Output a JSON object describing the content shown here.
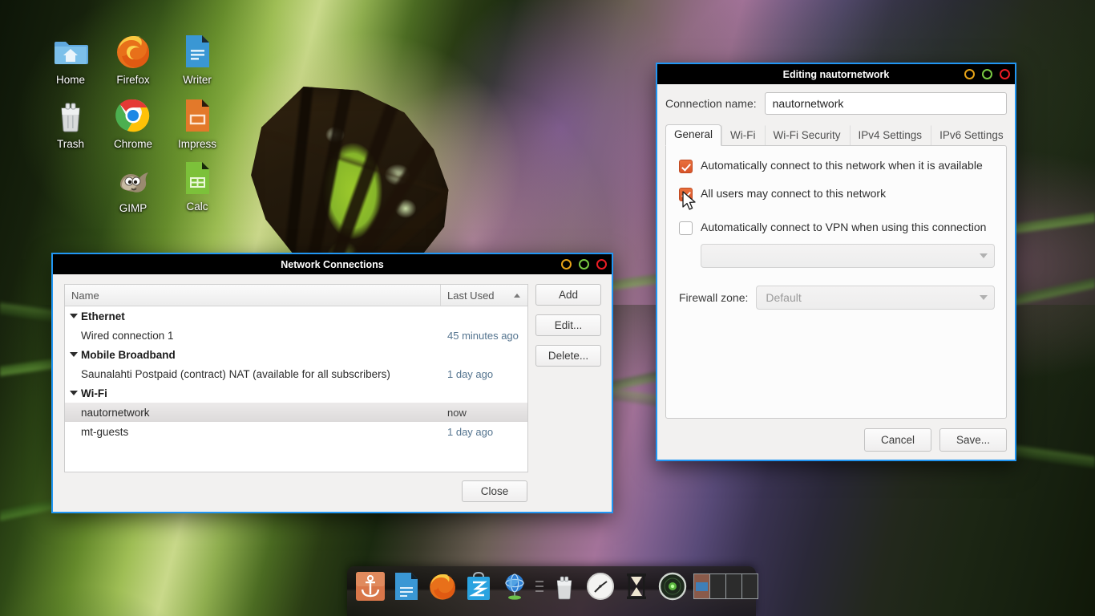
{
  "desktop": {
    "icons": [
      {
        "label": "Home",
        "icon": "home-folder-icon"
      },
      {
        "label": "Firefox",
        "icon": "firefox-icon"
      },
      {
        "label": "Writer",
        "icon": "libreoffice-writer-icon"
      },
      {
        "label": "Trash",
        "icon": "trash-icon"
      },
      {
        "label": "Chrome",
        "icon": "chrome-icon"
      },
      {
        "label": "Impress",
        "icon": "libreoffice-impress-icon"
      },
      {
        "label": "GIMP",
        "icon": "gimp-icon"
      },
      {
        "label": "Calc",
        "icon": "libreoffice-calc-icon"
      }
    ]
  },
  "dock": {
    "items": [
      {
        "name": "anchor-icon"
      },
      {
        "name": "text-editor-icon"
      },
      {
        "name": "firefox-icon"
      },
      {
        "name": "software-store-icon"
      },
      {
        "name": "network-globe-icon"
      },
      {
        "name": "separator"
      },
      {
        "name": "trash-icon"
      },
      {
        "name": "clock-icon"
      },
      {
        "name": "hourglass-icon"
      },
      {
        "name": "radar-icon"
      },
      {
        "name": "workspace-switcher-icon"
      }
    ]
  },
  "network_connections": {
    "title": "Network Connections",
    "window_buttons": {
      "minimize": "minimize-icon",
      "maximize": "maximize-icon",
      "close": "close-icon"
    },
    "columns": {
      "name": "Name",
      "last_used": "Last Used",
      "sort": "ascending"
    },
    "groups": [
      {
        "label": "Ethernet",
        "expanded": true,
        "rows": [
          {
            "name": "Wired connection 1",
            "last_used": "45 minutes ago",
            "selected": false
          }
        ]
      },
      {
        "label": "Mobile Broadband",
        "expanded": true,
        "rows": [
          {
            "name": "Saunalahti Postpaid (contract) NAT (available for all subscribers)",
            "last_used": "1 day ago",
            "selected": false
          }
        ]
      },
      {
        "label": "Wi-Fi",
        "expanded": true,
        "rows": [
          {
            "name": "nautornetwork",
            "last_used": "now",
            "selected": true
          },
          {
            "name": "mt-guests",
            "last_used": "1 day ago",
            "selected": false
          }
        ]
      }
    ],
    "buttons": {
      "add": "Add",
      "edit": "Edit...",
      "delete": "Delete...",
      "close": "Close"
    }
  },
  "edit_dialog": {
    "title": "Editing nautornetwork",
    "window_buttons": {
      "minimize": "minimize-icon",
      "maximize": "maximize-icon",
      "close": "close-icon"
    },
    "connection_name": {
      "label": "Connection name:",
      "value": "nautornetwork",
      "placeholder": ""
    },
    "tabs": [
      {
        "label": "General",
        "active": true
      },
      {
        "label": "Wi-Fi",
        "active": false
      },
      {
        "label": "Wi-Fi Security",
        "active": false
      },
      {
        "label": "IPv4 Settings",
        "active": false
      },
      {
        "label": "IPv6 Settings",
        "active": false
      }
    ],
    "general": {
      "checkboxes": [
        {
          "label": "Automatically connect to this network when it is available",
          "checked": true
        },
        {
          "label": "All users may connect to this network",
          "checked": true
        },
        {
          "label": "Automatically connect to VPN when using this connection",
          "checked": false
        }
      ],
      "vpn_combo": {
        "value": "",
        "enabled": false
      },
      "firewall_zone": {
        "label": "Firewall zone:",
        "value": "Default",
        "enabled": false
      }
    },
    "footer": {
      "cancel": "Cancel",
      "save": "Save..."
    }
  },
  "colors": {
    "titlebar_bg": "#000000",
    "window_border_active": "#2196f3",
    "checkbox_checked": "#d9542a",
    "minimize_ring": "#e8a317",
    "maximize_ring": "#7ac943",
    "close_ring": "#ed1c24",
    "selected_row": "#e3e1e1",
    "last_used_text": "#54748f"
  }
}
